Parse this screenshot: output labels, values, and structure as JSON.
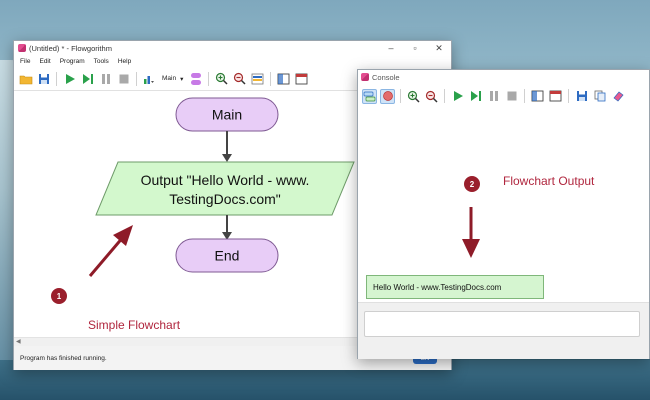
{
  "main_window": {
    "title": "(Untitled) * - Flowgorithm",
    "menu": [
      "File",
      "Edit",
      "Program",
      "Tools",
      "Help"
    ],
    "function_selector": "Main",
    "flowchart": {
      "start_label": "Main",
      "output_line1": "Output \"Hello World - www.",
      "output_line2": "TestingDocs.com\"",
      "end_label": "End"
    },
    "status": "Program has finished running.",
    "language_badge": "EN"
  },
  "console_window": {
    "title": "Console",
    "output_text": "Hello World - www.TestingDocs.com",
    "input_value": ""
  },
  "annotations": {
    "one_number": "1",
    "one_label": "Simple Flowchart",
    "two_number": "2",
    "two_label": "Flowchart Output"
  },
  "colors": {
    "terminal_fill": "#e8cdf7",
    "io_fill": "#d3f8cd",
    "annotation": "#b0263e",
    "arrow": "#8e1b28"
  }
}
